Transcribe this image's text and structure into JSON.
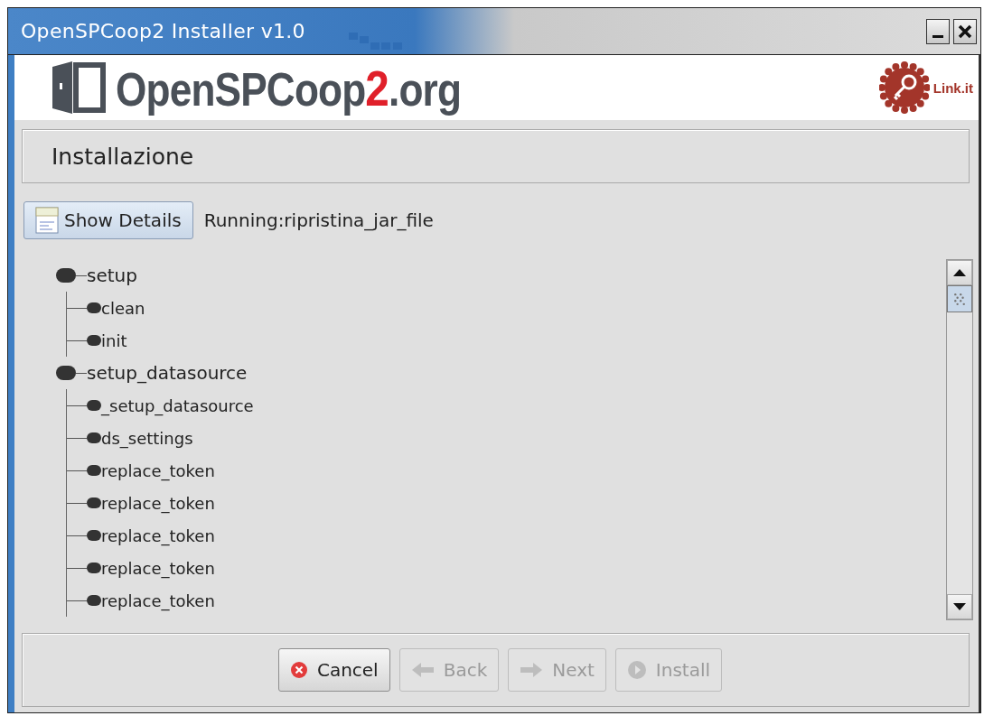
{
  "window": {
    "title": "OpenSPCoop2 Installer v1.0"
  },
  "header": {
    "logo": {
      "prefix": "OpenSPCoop",
      "number": "2",
      "suffix": ".org"
    },
    "brand": "Link.it"
  },
  "step_title": "Installazione",
  "details_button": {
    "label": "Show Details"
  },
  "status": "Running:ripristina_jar_file",
  "tree": [
    {
      "label": "setup",
      "children": [
        {
          "label": "clean"
        },
        {
          "label": "init"
        }
      ]
    },
    {
      "label": "setup_datasource",
      "children": [
        {
          "label": "_setup_datasource"
        },
        {
          "label": "ds_settings"
        },
        {
          "label": "replace_token"
        },
        {
          "label": "replace_token"
        },
        {
          "label": "replace_token"
        },
        {
          "label": "replace_token"
        },
        {
          "label": "replace_token"
        }
      ]
    }
  ],
  "buttons": [
    {
      "kind": "cancel",
      "label": "Cancel",
      "disabled": false
    },
    {
      "kind": "back",
      "label": "Back",
      "disabled": true
    },
    {
      "kind": "next",
      "label": "Next",
      "disabled": true
    },
    {
      "kind": "install",
      "label": "Install",
      "disabled": true
    }
  ]
}
